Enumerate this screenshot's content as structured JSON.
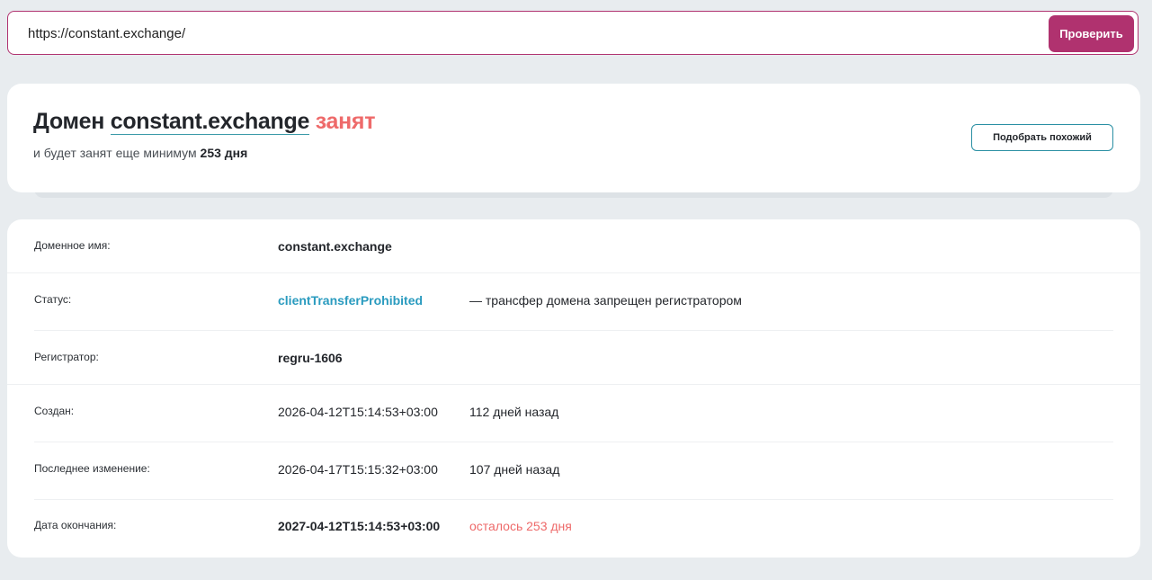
{
  "search": {
    "value": "https://constant.exchange/",
    "button_label": "Проверить"
  },
  "result": {
    "title_prefix": "Домен",
    "domain": "constant.exchange",
    "status_word": "занят",
    "subtitle_prefix": "и будет занят еще минимум",
    "subtitle_days": "253 дня",
    "similar_button_label": "Подобрать похожий"
  },
  "details": {
    "domain_name": {
      "label": "Доменное имя:",
      "value": "constant.exchange"
    },
    "status": {
      "label": "Статус:",
      "value": "clientTransferProhibited",
      "note": "— трансфер домена запрещен регистратором"
    },
    "registrar": {
      "label": "Регистратор:",
      "value": "regru-1606"
    },
    "created": {
      "label": "Создан:",
      "value": "2026-04-12T15:14:53+03:00",
      "note": "112 дней назад"
    },
    "modified": {
      "label": "Последнее изменение:",
      "value": "2026-04-17T15:15:32+03:00",
      "note": "107 дней назад"
    },
    "expires": {
      "label": "Дата окончания:",
      "value": "2027-04-12T15:14:53+03:00",
      "note": "осталось 253 дня"
    }
  },
  "colors": {
    "accent": "#b0326f",
    "busy": "#ee6a6a",
    "link": "#2a9bbf",
    "outline": "#2a8fa3",
    "background": "#e8ecef"
  }
}
